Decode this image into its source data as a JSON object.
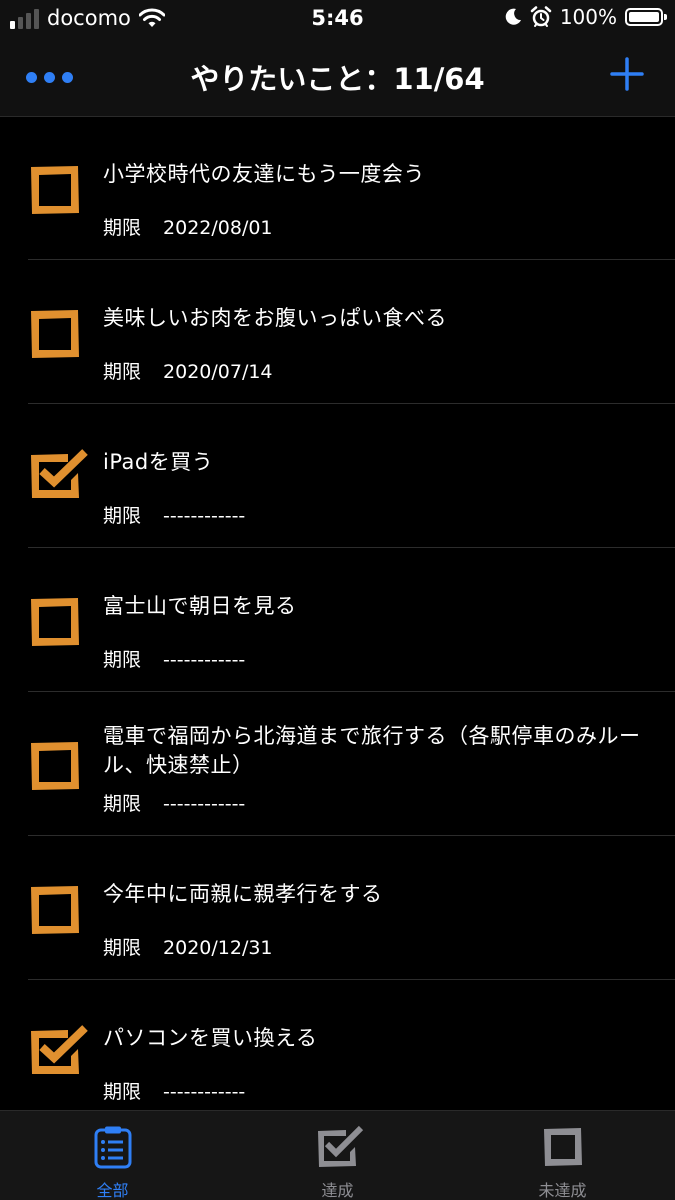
{
  "status_bar": {
    "carrier": "docomo",
    "time": "5:46",
    "battery": "100%",
    "signal_bars_filled": 1,
    "signal_bars_total": 4
  },
  "nav": {
    "title": "やりたいこと：11/64",
    "more_icon": "more-icon",
    "add_icon": "plus-icon",
    "accent_color": "#2f7ff5"
  },
  "colors": {
    "checkbox": "#e0902f",
    "background": "#000000",
    "tab_active": "#2f7ff5",
    "tab_inactive": "#8e8e93"
  },
  "deadline_label": "期限",
  "items": [
    {
      "title": "小学校時代の友達にもう一度会う",
      "deadline": "2022/08/01",
      "checked": false
    },
    {
      "title": "美味しいお肉をお腹いっぱい食べる",
      "deadline": "2020/07/14",
      "checked": false
    },
    {
      "title": "iPadを買う",
      "deadline": "------------",
      "checked": true
    },
    {
      "title": "富士山で朝日を見る",
      "deadline": "------------",
      "checked": false
    },
    {
      "title": "電車で福岡から北海道まで旅行する（各駅停車のみルール、快速禁止）",
      "deadline": "------------",
      "checked": false
    },
    {
      "title": "今年中に両親に親孝行をする",
      "deadline": "2020/12/31",
      "checked": false
    },
    {
      "title": "パソコンを買い換える",
      "deadline": "------------",
      "checked": true
    }
  ],
  "tabs": [
    {
      "label": "全部",
      "icon": "clipboard-list-icon",
      "active": true
    },
    {
      "label": "達成",
      "icon": "checked-box-icon",
      "active": false
    },
    {
      "label": "未達成",
      "icon": "empty-box-icon",
      "active": false
    }
  ]
}
